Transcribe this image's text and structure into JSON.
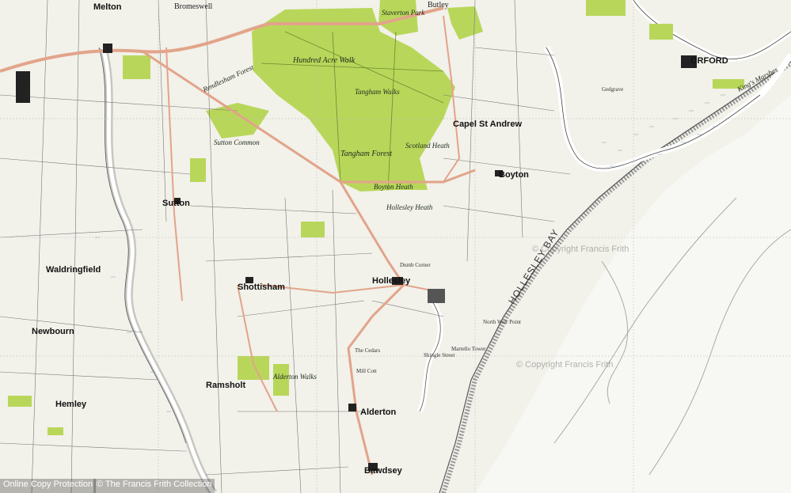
{
  "map": {
    "labels": {
      "melton": "Melton",
      "bromeswell": "Bromeswell",
      "butley": "Butley",
      "orford": "ORFORD",
      "sutton": "Sutton",
      "shottisham": "Shottisham",
      "hollesley": "Hollesley",
      "alderton": "Alderton",
      "bawdsey": "Bawdsey",
      "ramsholt": "Ramsholt",
      "boyton": "Boyton",
      "capel_st_andrew": "Capel St Andrew",
      "sutton_common": "Sutton Common",
      "newbourn": "Newbourn",
      "hemley": "Hemley",
      "waldringfield": "Waldringfield",
      "hundred_acre_walk": "Hundred Acre Walk",
      "tangham_forest": "Tangham Forest",
      "tangham_walks": "Tangham Walks",
      "scotland_heath": "Scotland Heath",
      "staverton_park": "Staverton Park",
      "boyton_heath": "Boyton Heath",
      "hollesley_heath": "Hollesley Heath",
      "hollesley_bay": "HOLLESLEY BAY",
      "north_weir_point": "North Weir Point",
      "martello_tower": "Martello Tower",
      "shingle_street": "Shingle Street",
      "mill_cott": "Mill Cott",
      "the_cedars": "The Cedars",
      "dumb_corner": "Dumb Corner",
      "alderton_walks": "Alderton Walks",
      "rendlesham": "Rendlesham Forest",
      "king_marshes": "King's Marshes",
      "gedgrave": "Gedgrave"
    },
    "watermarks": [
      "© Copyright Francis Frith",
      "© Copyright Francis Frith"
    ],
    "footer": {
      "left": "Online Copy Protection",
      "right": "© The Francis Frith Collection"
    },
    "colors": {
      "forest": "#b8d75a",
      "forest_dark": "#a7cc43",
      "paper": "#f2f1ea",
      "water": "#ffffff",
      "road": "#e2a48a",
      "field_line": "#777"
    }
  }
}
